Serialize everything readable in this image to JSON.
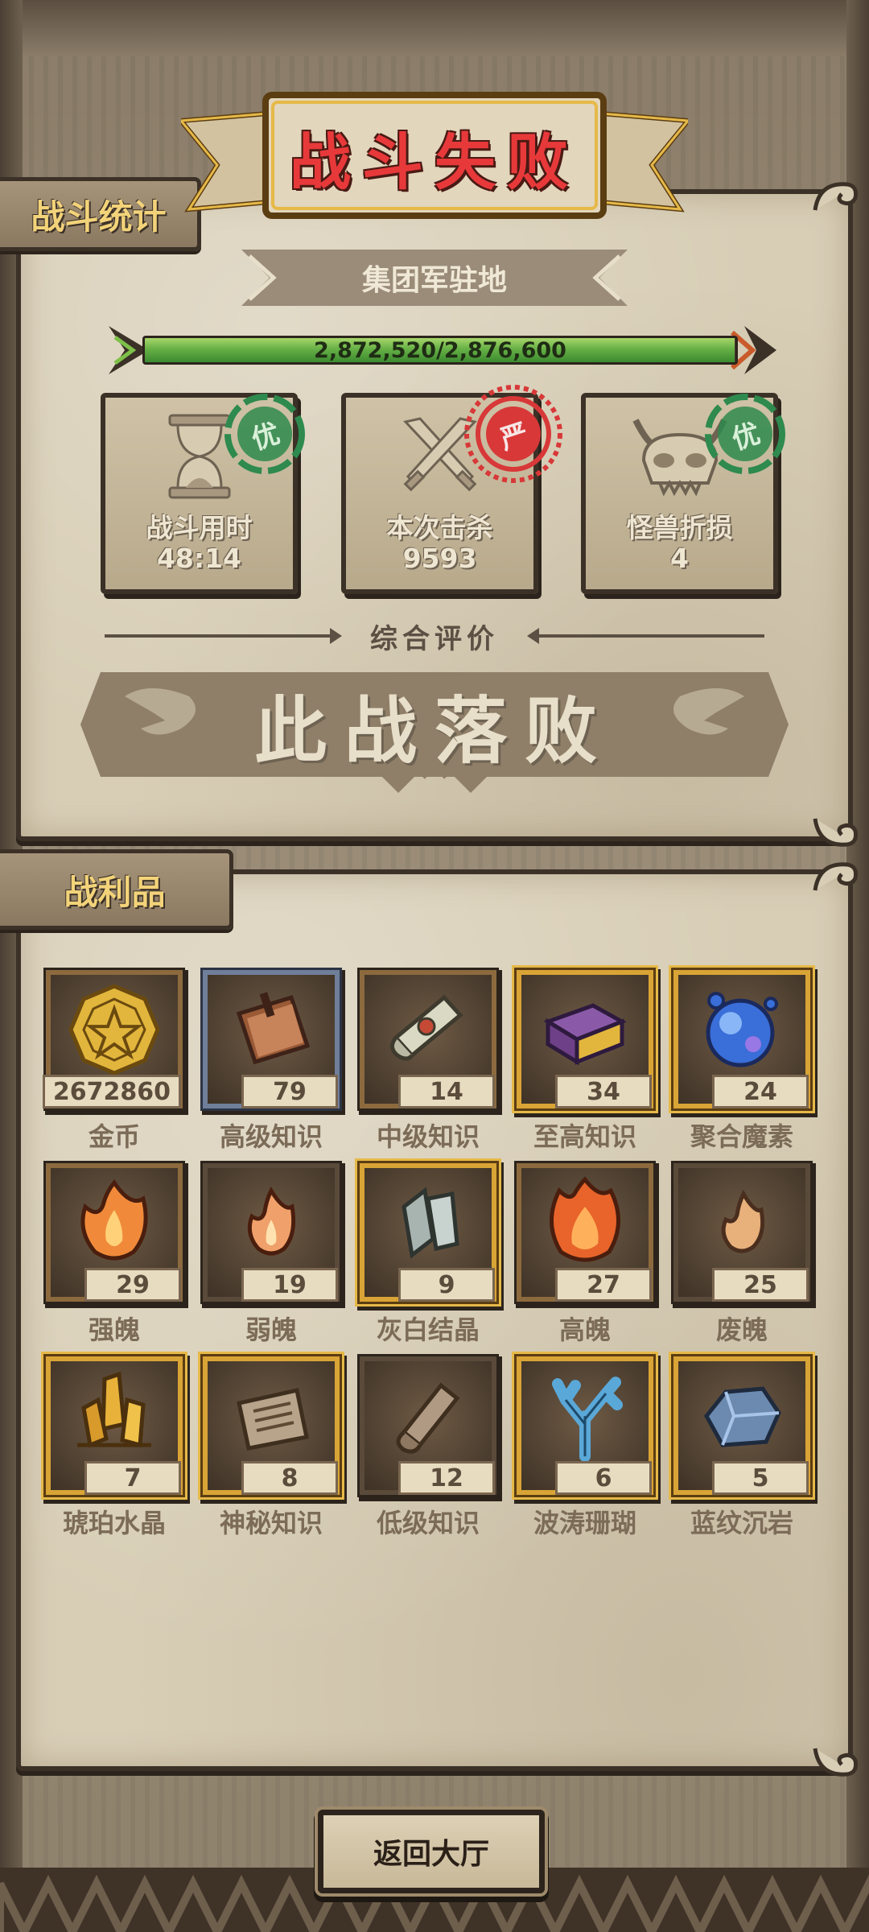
{
  "header": {
    "title": "战斗失败",
    "stats_tab": "战斗统计",
    "loot_tab": "战利品"
  },
  "location": "集团军驻地",
  "progress": {
    "text": "2,872,520/2,876,600",
    "current": 2872520,
    "max": 2876600,
    "fraction": 0.9986
  },
  "stats": [
    {
      "label": "战斗用时",
      "value": "48:14",
      "icon": "hourglass-icon",
      "stamp": "优",
      "stamp_color": "#2e8a4e"
    },
    {
      "label": "本次击杀",
      "value": "9593",
      "icon": "crossed-swords-icon",
      "stamp": "严",
      "stamp_color": "#d83838"
    },
    {
      "label": "怪兽折损",
      "value": "4",
      "icon": "monster-skull-icon",
      "stamp": "优",
      "stamp_color": "#2e8a4e"
    }
  ],
  "rating": {
    "heading": "综合评价",
    "verdict": "此战落败"
  },
  "loot": [
    {
      "name": "金币",
      "count": "2672860",
      "icon": "gold-coin-icon",
      "frame": "bronze"
    },
    {
      "name": "高级知识",
      "count": "79",
      "icon": "book-icon",
      "frame": "steel"
    },
    {
      "name": "中级知识",
      "count": "14",
      "icon": "scroll-icon",
      "frame": "bronze"
    },
    {
      "name": "至高知识",
      "count": "34",
      "icon": "tome-icon",
      "frame": "gold"
    },
    {
      "name": "聚合魔素",
      "count": "24",
      "icon": "magic-orb-icon",
      "frame": "gold"
    },
    {
      "name": "强魄",
      "count": "29",
      "icon": "soul-flame-icon",
      "frame": "bronze"
    },
    {
      "name": "弱魄",
      "count": "19",
      "icon": "small-flame-icon",
      "frame": "dark"
    },
    {
      "name": "灰白结晶",
      "count": "9",
      "icon": "grey-crystal-icon",
      "frame": "gold"
    },
    {
      "name": "高魄",
      "count": "27",
      "icon": "big-flame-icon",
      "frame": "bronze"
    },
    {
      "name": "废魄",
      "count": "25",
      "icon": "faint-flame-icon",
      "frame": "dark"
    },
    {
      "name": "琥珀水晶",
      "count": "7",
      "icon": "amber-crystal-icon",
      "frame": "gold"
    },
    {
      "name": "神秘知识",
      "count": "8",
      "icon": "stone-tablet-icon",
      "frame": "gold"
    },
    {
      "name": "低级知识",
      "count": "12",
      "icon": "worn-scroll-icon",
      "frame": "dark"
    },
    {
      "name": "波涛珊瑚",
      "count": "6",
      "icon": "coral-icon",
      "frame": "gold"
    },
    {
      "name": "蓝纹沉岩",
      "count": "5",
      "icon": "blue-rock-icon",
      "frame": "gold"
    }
  ],
  "return_button": "返回大厅",
  "colors": {
    "title_red": "#e8393a",
    "tab_gold": "#f3d37a",
    "parchment": "#d8ceb6",
    "progress_green": "#66b046"
  }
}
